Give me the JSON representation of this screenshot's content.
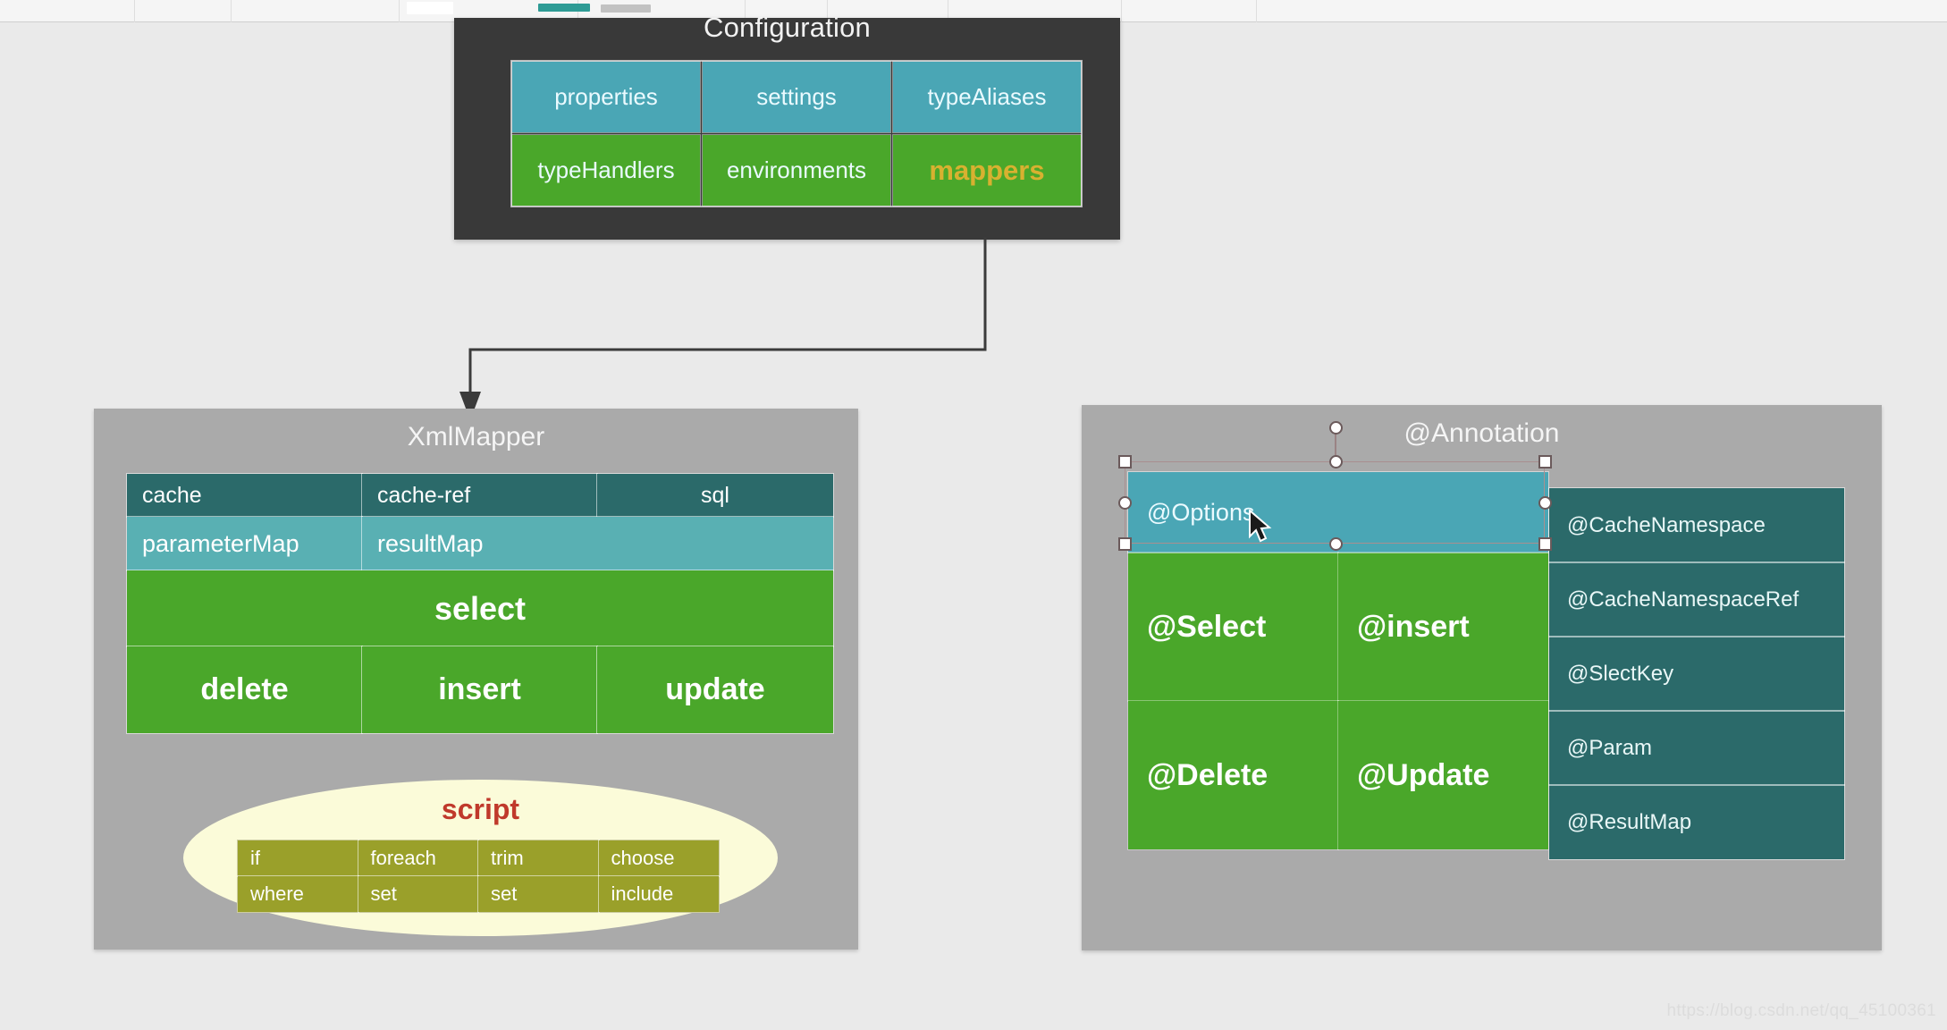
{
  "toolbar": {
    "swatch_teal": "#2e9b95",
    "swatch_grey": "#c2c2c2"
  },
  "configuration": {
    "title": "Configuration",
    "cells": [
      {
        "label": "properties",
        "style": "teal"
      },
      {
        "label": "settings",
        "style": "teal"
      },
      {
        "label": "typeAliases",
        "style": "teal"
      },
      {
        "label": "typeHandlers",
        "style": "green"
      },
      {
        "label": "environments",
        "style": "green"
      },
      {
        "label": "mappers",
        "style": "green",
        "highlight": true
      }
    ],
    "panel_color": "#393939",
    "teal_color": "#4aa6b5",
    "green_color": "#4aa72a",
    "highlight_color": "#d8b130"
  },
  "xml_mapper": {
    "title": "XmlMapper",
    "row1": [
      {
        "label": "cache"
      },
      {
        "label": "cache-ref"
      },
      {
        "label": "sql"
      }
    ],
    "row2": [
      {
        "label": "parameterMap"
      },
      {
        "label": "resultMap"
      }
    ],
    "row3": [
      {
        "label": "select"
      }
    ],
    "row4": [
      {
        "label": "delete"
      },
      {
        "label": "insert"
      },
      {
        "label": "update"
      }
    ],
    "script": {
      "label": "script",
      "label_color": "#c0392b",
      "rows": [
        [
          "if",
          "foreach",
          "trim",
          "choose"
        ],
        [
          "where",
          "set",
          "set",
          "include"
        ]
      ]
    }
  },
  "annotation": {
    "title": "@Annotation",
    "options_cell": "@Options",
    "grid": [
      "@Select",
      "@insert",
      "@Delete",
      "@Update"
    ],
    "right_column": [
      "@CacheNamespace",
      "@CacheNamespaceRef",
      "@SlectKey",
      "@Param",
      "@ResultMap"
    ]
  },
  "watermark": "https://blog.csdn.net/qq_45100361"
}
